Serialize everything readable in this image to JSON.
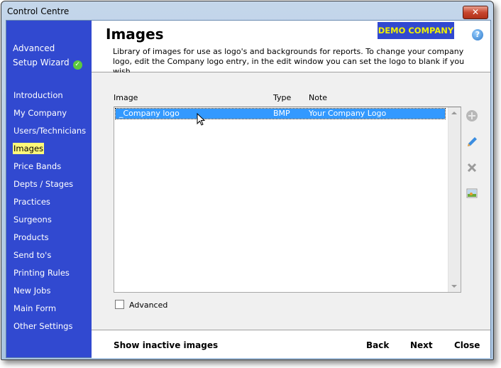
{
  "window": {
    "title": "Control Centre",
    "close_label": "✕"
  },
  "sidebar": {
    "wizard_line1": "Advanced",
    "wizard_line2": "Setup Wizard",
    "items": [
      {
        "label": "Introduction",
        "active": false
      },
      {
        "label": "My Company",
        "active": false
      },
      {
        "label": "Users/Technicians",
        "active": false
      },
      {
        "label": "Images",
        "active": true
      },
      {
        "label": "Price Bands",
        "active": false
      },
      {
        "label": "Depts / Stages",
        "active": false
      },
      {
        "label": "Practices",
        "active": false
      },
      {
        "label": "Surgeons",
        "active": false
      },
      {
        "label": "Products",
        "active": false
      },
      {
        "label": "Send to's",
        "active": false
      },
      {
        "label": "Printing Rules",
        "active": false
      },
      {
        "label": "New Jobs",
        "active": false
      },
      {
        "label": "Main Form",
        "active": false
      },
      {
        "label": "Other Settings",
        "active": false
      }
    ]
  },
  "header": {
    "title": "Images",
    "company_badge": "DEMO COMPANY",
    "help_label": "?",
    "description": "Library of images for use as logo's and backgrounds for reports. To change your company logo, edit the Company logo entry, in the edit window you can set the logo to blank if you wish."
  },
  "list": {
    "columns": [
      "Image",
      "Type",
      "Note"
    ],
    "rows": [
      {
        "image": "_Company logo",
        "type": "BMP",
        "note": "Your Company Logo",
        "selected": true
      }
    ]
  },
  "tools": {
    "add": "add-icon",
    "edit": "pencil-icon",
    "delete": "delete-icon",
    "image": "image-icon"
  },
  "advanced_checkbox": {
    "label": "Advanced",
    "checked": false
  },
  "footer": {
    "show_inactive": "Show inactive images",
    "back": "Back",
    "next": "Next",
    "close": "Close"
  },
  "colors": {
    "sidebar": "#3149d0",
    "highlight": "#fff87a",
    "selection": "#3399ff",
    "badge_text": "#f0f000"
  }
}
